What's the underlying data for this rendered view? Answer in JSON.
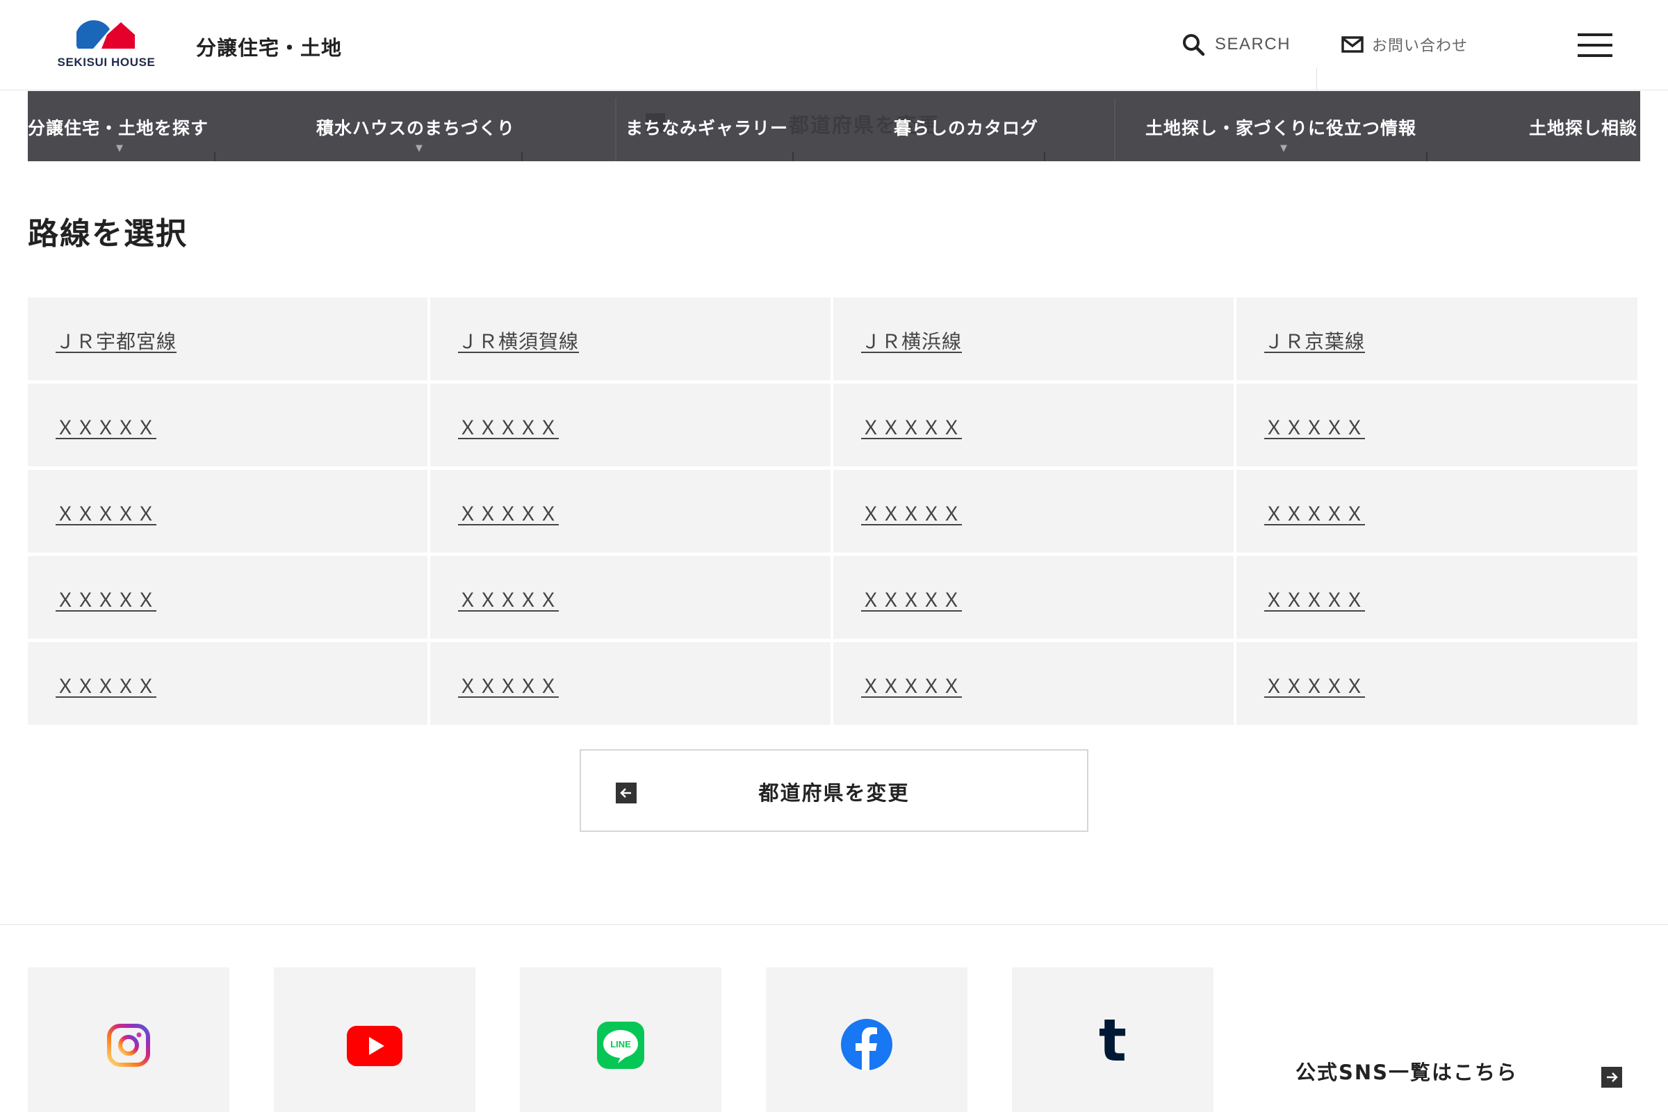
{
  "header": {
    "logo_text": "SEKISUI HOUSE",
    "site_title": "分譲住宅・土地",
    "search_label": "SEARCH",
    "contact_label": "お問い合わせ"
  },
  "nav": {
    "items": [
      {
        "label": "分譲住宅・土地を探す",
        "has_dropdown": true
      },
      {
        "label": "積水ハウスのまちづくり",
        "has_dropdown": true
      },
      {
        "label": "まちなみギャラリー",
        "has_dropdown": false
      },
      {
        "label": "暮らしのカタログ",
        "has_dropdown": false
      },
      {
        "label": "土地探し・家づくりに役立つ情報",
        "has_dropdown": true
      },
      {
        "label": "土地探し相談",
        "has_dropdown": false
      }
    ],
    "background_ghost_text": "都道府県を変更"
  },
  "main": {
    "page_title": "路線を選択",
    "routes": [
      "ＪＲ宇都宮線",
      "ＪＲ横須賀線",
      "ＪＲ横浜線",
      "ＪＲ京葉線",
      "ＸＸＸＸＸ",
      "ＸＸＸＸＸ",
      "ＸＸＸＸＸ",
      "ＸＸＸＸＸ",
      "ＸＸＸＸＸ",
      "ＸＸＸＸＸ",
      "ＸＸＸＸＸ",
      "ＸＸＸＸＸ",
      "ＸＸＸＸＸ",
      "ＸＸＸＸＸ",
      "ＸＸＸＸＸ",
      "ＸＸＸＸＸ",
      "ＸＸＸＸＸ",
      "ＸＸＸＸＸ",
      "ＸＸＸＸＸ",
      "ＸＸＸＸＸ"
    ],
    "change_prefecture_label": "都道府県を変更"
  },
  "footer": {
    "sns": [
      {
        "name": "instagram-icon"
      },
      {
        "name": "youtube-icon"
      },
      {
        "name": "line-icon",
        "icon_text": "LINE"
      },
      {
        "name": "facebook-icon"
      },
      {
        "name": "tumblr-icon",
        "icon_text": "t"
      }
    ],
    "sns_list_label": "公式SNS一覧はこちら"
  },
  "colors": {
    "nav_bg": "#4b4a4f",
    "cell_bg": "#f3f3f3",
    "logo_blue": "#1a66b8",
    "logo_red": "#e4002b",
    "youtube_red": "#ff0000",
    "line_green": "#06c755",
    "facebook_blue": "#1877f2",
    "tumblr_navy": "#001935"
  }
}
